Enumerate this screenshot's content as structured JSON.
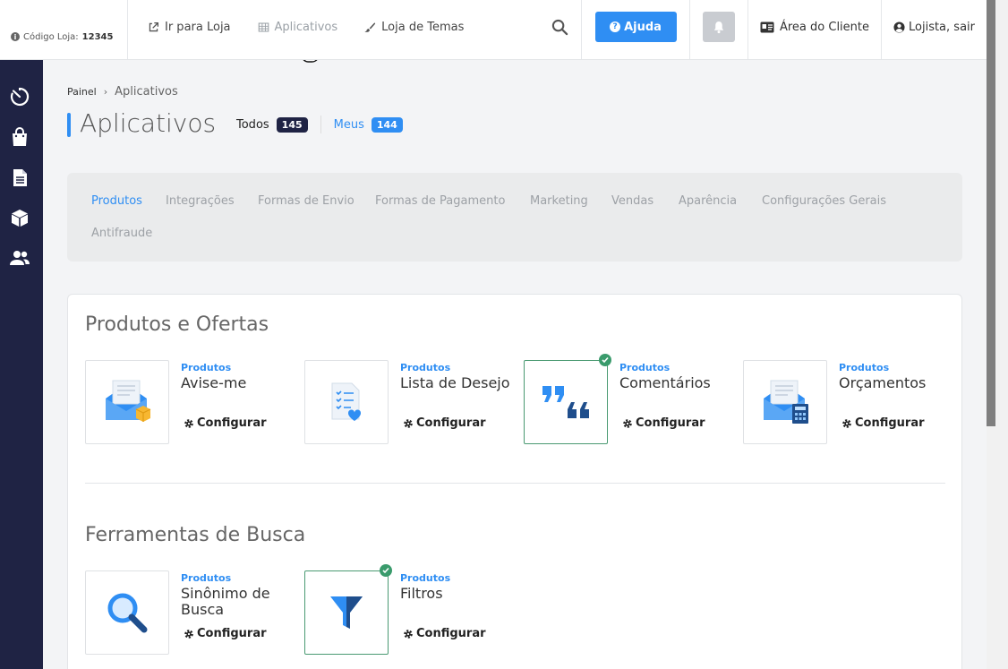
{
  "header": {
    "store_code_label": "Código Loja:",
    "store_code_value": "12345",
    "nav": [
      {
        "label": "Ir para Loja",
        "icon": "external-link-icon"
      },
      {
        "label": "Aplicativos",
        "icon": "grid-icon"
      },
      {
        "label": "Loja de Temas",
        "icon": "brush-icon"
      }
    ],
    "help_label": "Ajuda",
    "client_area_label": "Área do Cliente",
    "logout_label": "Lojista, sair"
  },
  "breadcrumb": {
    "root": "Painel",
    "current": "Aplicativos"
  },
  "page": {
    "title": "Aplicativos",
    "filters": [
      {
        "label": "Todos",
        "count": "145",
        "color": "#1f2344"
      },
      {
        "label": "Meus",
        "count": "144",
        "color": "#2f8ef3"
      }
    ]
  },
  "categories": [
    "Produtos",
    "Integrações",
    "Formas de Envio",
    "Formas de Pagamento",
    "Marketing",
    "Vendas",
    "Aparência",
    "Configurações Gerais",
    "Antifraude"
  ],
  "sections": [
    {
      "title": "Produtos e Ofertas",
      "apps": [
        {
          "category": "Produtos",
          "name": "Avise-me",
          "config": "Configurar",
          "installed": false
        },
        {
          "category": "Produtos",
          "name": "Lista de Desejo",
          "config": "Configurar",
          "installed": false
        },
        {
          "category": "Produtos",
          "name": "Comentários",
          "config": "Configurar",
          "installed": true
        },
        {
          "category": "Produtos",
          "name": "Orçamentos",
          "config": "Configurar",
          "installed": false
        }
      ]
    },
    {
      "title": "Ferramentas de Busca",
      "apps": [
        {
          "category": "Produtos",
          "name": "Sinônimo de Busca",
          "config": "Configurar",
          "installed": false
        },
        {
          "category": "Produtos",
          "name": "Filtros",
          "config": "Configurar",
          "installed": true
        }
      ]
    }
  ],
  "colors": {
    "accent": "#2f8ef3",
    "sidebar": "#1f2344",
    "installed": "#3a9b6c"
  }
}
